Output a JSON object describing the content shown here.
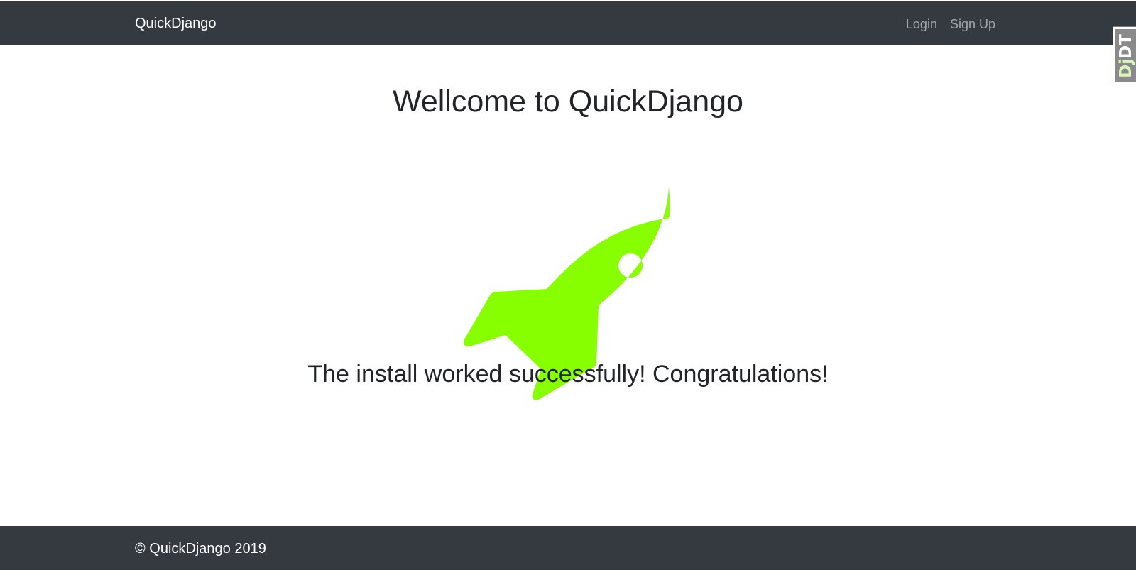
{
  "navbar": {
    "brand": "QuickDjango",
    "links": [
      {
        "label": "Login"
      },
      {
        "label": "Sign Up"
      }
    ]
  },
  "main": {
    "title": "Wellcome to QuickDjango",
    "icon": "rocket-icon",
    "icon_color": "#88ff00",
    "message": "The install worked successfully! Congratulations!"
  },
  "footer": {
    "copyright": "© QuickDjango 2019"
  },
  "debug_toolbar": {
    "handle_prefix": "Dj",
    "handle_suffix": "DT"
  },
  "colors": {
    "navbar_bg": "#343a40",
    "footer_bg": "#343a40",
    "accent": "#88ff00"
  }
}
